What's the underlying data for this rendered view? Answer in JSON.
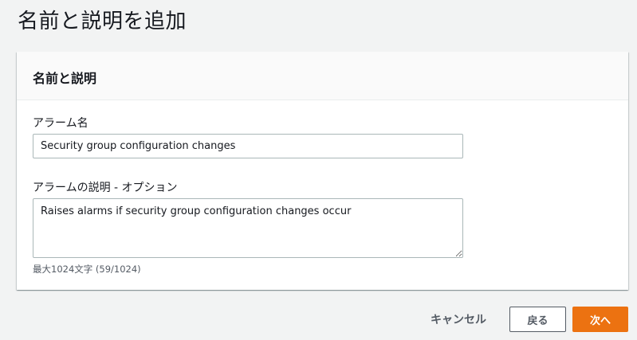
{
  "page": {
    "title": "名前と説明を追加"
  },
  "panel": {
    "header": "名前と説明",
    "alarm_name": {
      "label": "アラーム名",
      "value": "Security group configuration changes"
    },
    "alarm_description": {
      "label": "アラームの説明 - オプション",
      "value": "Raises alarms if security group configuration changes occur",
      "hint": "最大1024文字 (59/1024)"
    }
  },
  "footer": {
    "cancel_label": "キャンセル",
    "back_label": "戻る",
    "next_label": "次へ"
  },
  "colors": {
    "primary": "#ec7211",
    "background": "#f2f3f3",
    "text": "#16191f",
    "muted": "#545b64"
  }
}
